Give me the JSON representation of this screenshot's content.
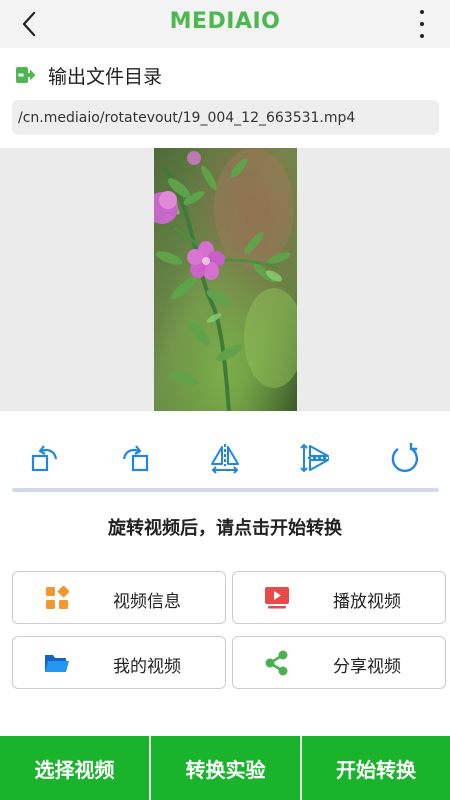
{
  "header": {
    "title": "MEDIAIO",
    "back_icon": "chevron-left-icon",
    "menu_icon": "more-vertical-icon"
  },
  "output": {
    "label": "输出文件目录",
    "icon": "export-icon",
    "path": "/cn.mediaio/rotatevout/19_004_12_663531.mp4"
  },
  "toolbar": {
    "items": [
      {
        "icon": "rotate-left-icon"
      },
      {
        "icon": "rotate-right-icon"
      },
      {
        "icon": "flip-horizontal-icon"
      },
      {
        "icon": "flip-vertical-icon"
      },
      {
        "icon": "reset-rotation-icon"
      }
    ]
  },
  "hint": "旋转视频后，请点击开始转换",
  "actions": {
    "video_info": "视频信息",
    "play_video": "播放视频",
    "my_videos": "我的视频",
    "share_video": "分享视频"
  },
  "bottom": {
    "select": "选择视频",
    "experiment": "转换实验",
    "start": "开始转换"
  },
  "colors": {
    "brand_green": "#4cb84f",
    "bottom_bar": "#19b32c",
    "icon_blue": "#1f87e0",
    "icon_orange": "#f5962e",
    "icon_red": "#e84a4a",
    "share_green": "#4caf50"
  }
}
